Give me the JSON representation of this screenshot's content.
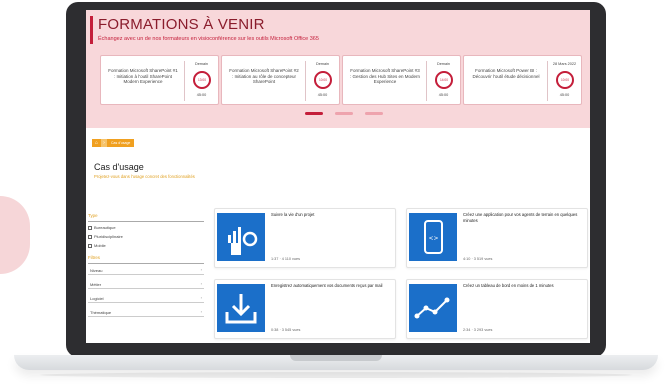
{
  "banner": {
    "title": "FORMATIONS À VENIR",
    "subtitle": "Échangez avec un de nos formateurs en visioconférence sur les outils Microsoft Office 365",
    "cards": [
      {
        "text": "Formation Microsoft SharePoint #1 : Initiation à l'outil SharePoint Modern Experience",
        "date": "Demain",
        "time": "13:00",
        "duration": "45:00"
      },
      {
        "text": "Formation Microsoft SharePoint #2 : Initiation au rôle de concepteur SharePoint",
        "date": "Demain",
        "time": "10:00",
        "duration": "45:00"
      },
      {
        "text": "Formation Microsoft SharePoint #3 : Gestion des Hub Sites en Modern Experience",
        "date": "Demain",
        "time": "14:00",
        "duration": "45:00"
      },
      {
        "text": "Formation Microsoft Power BI : Découvrir l'outil étude décisionnel",
        "date": "28 Mars 2022",
        "time": "10:00",
        "duration": "45:00"
      }
    ]
  },
  "breadcrumb": {
    "item": "Cas d'usage"
  },
  "section": {
    "title": "Cas d'usage",
    "subtitle": "Projetez-vous dans l'usage concret des fonctionnalités"
  },
  "filters": {
    "type_label": "Type",
    "types": [
      "Bureautique",
      "Pluridisciplinaire",
      "Mobile"
    ],
    "filters_label": "Filtres",
    "rows": [
      "Niveau",
      "Métier",
      "Logiciel",
      "Thématique"
    ]
  },
  "tiles": [
    {
      "title": "Suivre la vie d'un projet",
      "meta": "1:37  ·  4 110 vues"
    },
    {
      "title": "Créez une application pour vos agents de terrain en quelques minutes",
      "meta": "4:10  ·  3 519 vues"
    },
    {
      "title": "Enregistrez automatiquement vos documents reçus par mail",
      "meta": "0:38  ·  3 545 vues"
    },
    {
      "title": "Créez un tableau de bord en moins de 1 minutes",
      "meta": "2:34  ·  3 293 vues"
    }
  ],
  "icons": {
    "home": "home-icon",
    "chevron": "chevron-down-icon",
    "clock": "clock-icon"
  },
  "colors": {
    "accent": "#c41e3a",
    "banner_bg": "#f8d7da",
    "orange": "#f0a020",
    "tile_blue": "#1b6fc9"
  }
}
